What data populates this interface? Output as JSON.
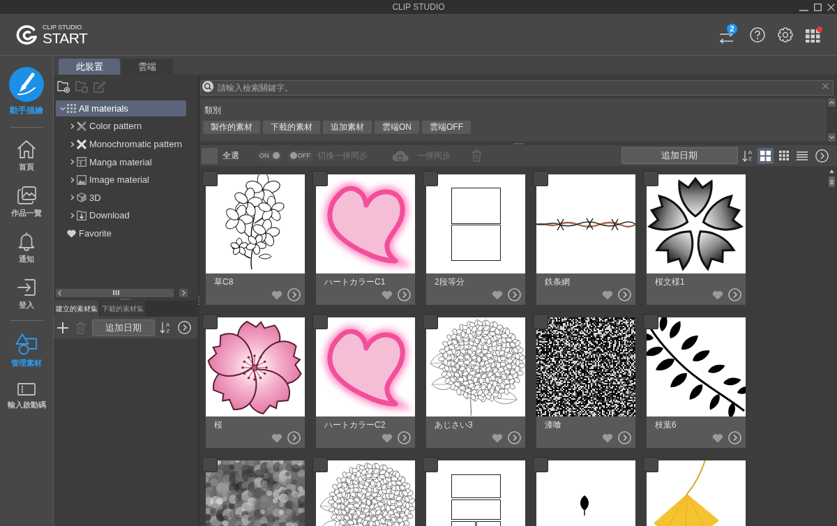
{
  "window": {
    "title": "CLIP STUDIO"
  },
  "header": {
    "logo": {
      "small": "CLIP STUDIO",
      "large": "START"
    },
    "transfer_badge": "2",
    "apps_alert": true
  },
  "draw_button": {
    "label": "動手描繪"
  },
  "nav_groups": [
    {
      "items": [
        {
          "kind": "home",
          "label": "首頁",
          "selected": false
        },
        {
          "kind": "works",
          "label": "作品一覽",
          "selected": false
        },
        {
          "kind": "notifications",
          "label": "通知",
          "selected": false
        },
        {
          "kind": "login",
          "label": "登入",
          "selected": false
        }
      ]
    },
    {
      "items": [
        {
          "kind": "materials",
          "label": "管理素材",
          "selected": true
        },
        {
          "kind": "redeem",
          "label": "輸入啟動碼",
          "selected": false
        }
      ]
    }
  ],
  "location_tabs": [
    {
      "label": "此裝置",
      "selected": true
    },
    {
      "label": "雲端",
      "selected": false
    }
  ],
  "folder_tools": [
    {
      "kind": "new-folder",
      "disabled": false
    },
    {
      "kind": "duplicate",
      "disabled": true
    },
    {
      "kind": "edit",
      "disabled": true
    }
  ],
  "tree": [
    {
      "kind": "all",
      "label": "All materials",
      "expanded": true,
      "selected": true,
      "children": [
        {
          "kind": "color-pattern",
          "label": "Color pattern",
          "expanded": false,
          "selected": false
        },
        {
          "kind": "mono-pattern",
          "label": "Monochromatic pattern",
          "expanded": false,
          "selected": false
        },
        {
          "kind": "manga",
          "label": "Manga material",
          "expanded": false,
          "selected": false
        },
        {
          "kind": "image",
          "label": "Image material",
          "expanded": false,
          "selected": false
        },
        {
          "kind": "model",
          "label": "3D",
          "expanded": false,
          "selected": false
        },
        {
          "kind": "download",
          "label": "Download",
          "expanded": false,
          "selected": false
        }
      ]
    },
    {
      "kind": "favorite",
      "label": "Favorite",
      "selected": false
    }
  ],
  "set_tabs": [
    {
      "label": "建立的素材集",
      "selected": true
    },
    {
      "label": "下載的素材集",
      "selected": false
    }
  ],
  "set_toolbar": {
    "delete_disabled": true,
    "sort": "追加日期",
    "sort_letters": [
      "A",
      "Z"
    ]
  },
  "search": {
    "placeholder": "請輸入檢索關鍵字。"
  },
  "category": {
    "title": "類別",
    "chips": [
      {
        "label": "製作的素材",
        "selected": false
      },
      {
        "label": "下載的素材",
        "selected": false
      },
      {
        "label": "追加素材",
        "selected": false
      },
      {
        "label": "雲端ON",
        "selected": false
      },
      {
        "label": "雲端OFF",
        "selected": false
      }
    ]
  },
  "toolbar": {
    "select_all": {
      "label": "全選",
      "checked": false
    },
    "switches": [
      {
        "label": "ON",
        "on": true
      },
      {
        "label": "OFF",
        "on": false
      }
    ],
    "switch_label": "切換一併同步",
    "sync_label": "一併同步",
    "sync_disabled": true,
    "sort": "追加日期",
    "sort_letters": [
      "A",
      "Z"
    ],
    "views": [
      {
        "kind": "large-grid",
        "selected": true
      },
      {
        "kind": "small-grid",
        "selected": false
      },
      {
        "kind": "list",
        "selected": false
      }
    ]
  },
  "materials": [
    {
      "kind": "flower-lineart",
      "name": "草C8",
      "checked": false,
      "favorite": false
    },
    {
      "kind": "heart",
      "name": "ハートカラーC1",
      "checked": false,
      "favorite": false
    },
    {
      "kind": "two-panels",
      "name": "2段等分",
      "checked": false,
      "favorite": false
    },
    {
      "kind": "barbed-wire",
      "name": "鉄条網",
      "checked": false,
      "favorite": false
    },
    {
      "kind": "flower-pattern",
      "name": "桜文様1",
      "checked": false,
      "favorite": false
    },
    {
      "kind": "blossom",
      "name": "桜",
      "checked": false,
      "favorite": false
    },
    {
      "kind": "heart",
      "name": "ハートカラーC2",
      "checked": false,
      "favorite": false
    },
    {
      "kind": "hydrangea",
      "name": "あじさい3",
      "checked": false,
      "favorite": false
    },
    {
      "kind": "noise",
      "name": "漆喰",
      "checked": false,
      "favorite": false
    },
    {
      "kind": "leaves",
      "name": "枝葉6",
      "checked": false,
      "favorite": false
    },
    {
      "kind": "stone",
      "checked": false
    },
    {
      "kind": "hydrangea",
      "checked": false
    },
    {
      "kind": "panels",
      "checked": false
    },
    {
      "kind": "leaf",
      "checked": false
    },
    {
      "kind": "ginkgo",
      "checked": false
    }
  ]
}
